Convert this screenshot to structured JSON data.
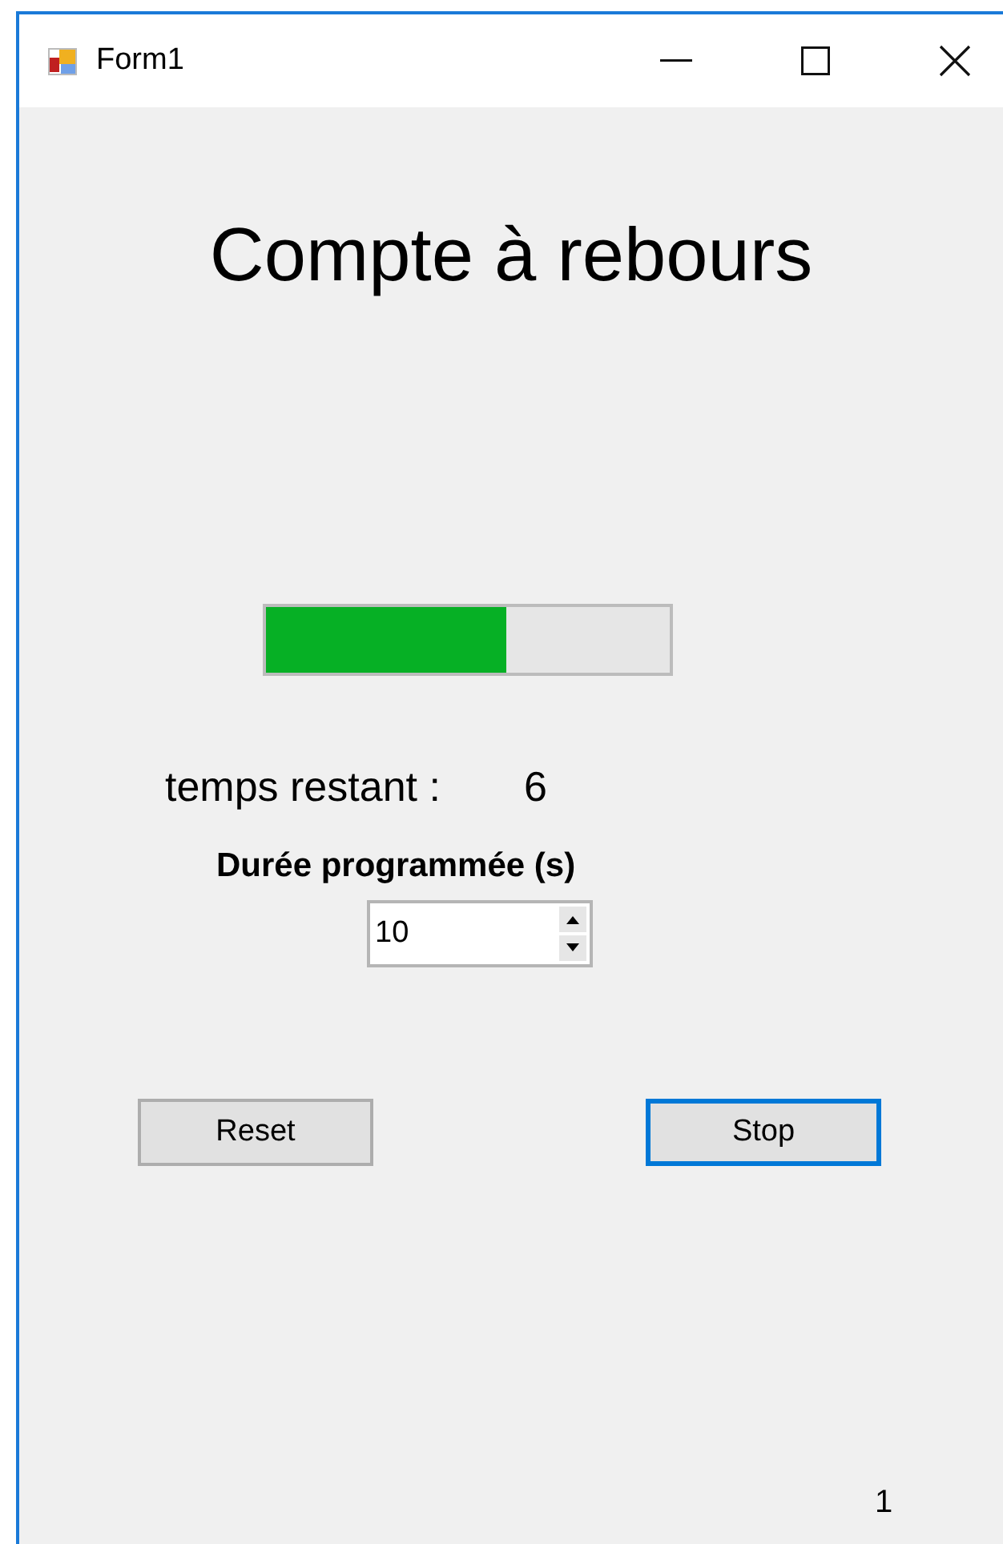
{
  "window": {
    "title": "Form1"
  },
  "heading": "Compte à rebours",
  "progress": {
    "level": 0.595
  },
  "remaining": {
    "label": "temps restant :",
    "value": "6"
  },
  "duration": {
    "label": "Durée programmée (s)",
    "value": "10"
  },
  "buttons": [
    {
      "label": "Reset",
      "focused": false
    },
    {
      "label": "Stop",
      "focused": true
    }
  ],
  "footer_text": "1"
}
